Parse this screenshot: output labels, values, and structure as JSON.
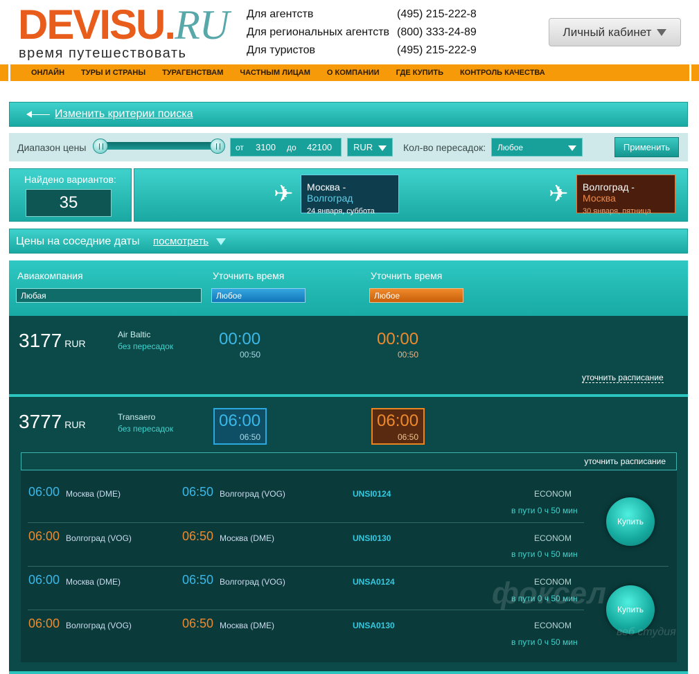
{
  "header": {
    "logo_main": "DEVISU.",
    "logo_accent": "RU",
    "logo_sub": "время путешествовать",
    "contacts": [
      {
        "label": "Для агентств",
        "phone": "(495) 215-222-8"
      },
      {
        "label": "Для региональных агентств",
        "phone": "(800) 333-24-89"
      },
      {
        "label": "Для туристов",
        "phone": "(495) 215-222-9"
      }
    ],
    "cabinet_label": "Личный кабинет"
  },
  "nav": [
    "ОНЛАЙН",
    "ТУРЫ И СТРАНЫ",
    "ТУРАГЕНСТВАМ",
    "ЧАСТНЫМ ЛИЦАМ",
    "О КОМПАНИИ",
    "ГДЕ КУПИТЬ",
    "КОНТРОЛЬ КАЧЕСТВА"
  ],
  "search": {
    "change_label": "Изменить критерии поиска"
  },
  "filter": {
    "price_range_label": "Диапазон цены",
    "from_label": "от",
    "from_value": "3100",
    "to_label": "до",
    "to_value": "42100",
    "currency": "RUR",
    "stops_label": "Кол-во пересадок:",
    "stops_value": "Любое",
    "apply_label": "Применить"
  },
  "found": {
    "label": "Найдено вариантов:",
    "count": "35"
  },
  "route": {
    "out": {
      "from": "Москва",
      "dash": " - ",
      "to": "Волгоград",
      "date": "24 января, суббота"
    },
    "back": {
      "from": "Волгоград",
      "dash": " - ",
      "to": "Москва",
      "date": "30 января, пятница"
    }
  },
  "dates": {
    "label": "Цены на соседние даты",
    "link": "посмотреть"
  },
  "panel": {
    "airline_label": "Авиакомпания",
    "airline_value": "Любая",
    "time_label_1": "Уточнить время",
    "time_value_1": "Любое",
    "time_label_2": "Уточнить время",
    "time_value_2": "Любое"
  },
  "results": [
    {
      "price": "3177",
      "currency": "RUR",
      "airline": "Air Baltic",
      "stops": "без пересадок",
      "out_time": "00:00",
      "out_sub": "00:50",
      "back_time": "00:00",
      "back_sub": "00:50",
      "schedule_link": "уточнить расписание"
    },
    {
      "price": "3777",
      "currency": "RUR",
      "airline": "Transaero",
      "stops": "без пересадок",
      "out_time": "06:00",
      "out_sub": "06:50",
      "back_time": "06:00",
      "back_sub": "06:50",
      "schedule_link": "уточнить расписание"
    }
  ],
  "details": [
    {
      "dep_time": "06:00",
      "dep_city": "Москва (DME)",
      "arr_time": "06:50",
      "arr_city": "Волгоград (VOG)",
      "flight": "UNSI0124",
      "class": "ECONOM",
      "duration": "в пути 0 ч 50 мин",
      "dir": "out"
    },
    {
      "dep_time": "06:00",
      "dep_city": "Волгоград (VOG)",
      "arr_time": "06:50",
      "arr_city": "Москва (DME)",
      "flight": "UNSI0130",
      "class": "ECONOM",
      "duration": "в пути 0 ч 50 мин",
      "dir": "back"
    },
    {
      "dep_time": "06:00",
      "dep_city": "Москва (DME)",
      "arr_time": "06:50",
      "arr_city": "Волгоград (VOG)",
      "flight": "UNSA0124",
      "class": "ECONOM",
      "duration": "в пути 0 ч 50 мин",
      "dir": "out"
    },
    {
      "dep_time": "06:00",
      "dep_city": "Волгоград (VOG)",
      "arr_time": "06:50",
      "arr_city": "Москва (DME)",
      "flight": "UNSA0130",
      "class": "ECONOM",
      "duration": "в пути 0 ч 50 мин",
      "dir": "back"
    }
  ],
  "buy_label": "Купить",
  "watermark": {
    "main": "фоксел",
    "sub": "веб студия"
  }
}
